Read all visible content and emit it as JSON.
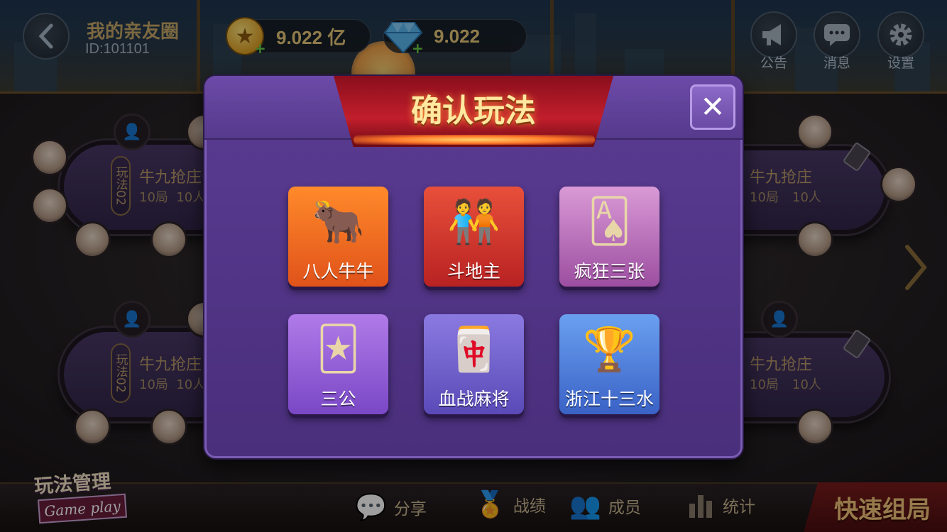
{
  "header": {
    "club_name": "我的亲友圈",
    "club_id": "ID:101101",
    "gold": "9.022 亿",
    "diamonds": "9.022",
    "notice_label": "公告",
    "message_label": "消息",
    "settings_label": "设置"
  },
  "tables": {
    "left_top": {
      "tag": "玩法02",
      "title": "牛九抢庄",
      "sub": "10局  10人"
    },
    "left_bottom": {
      "tag": "玩法02",
      "title": "牛九抢庄",
      "sub": "10局  10人"
    },
    "right_top": {
      "title": "牛九抢庄",
      "rounds": "10局",
      "players": "10人"
    },
    "right_bottom": {
      "title": "牛九抢庄",
      "rounds": "10局",
      "players": "10人"
    }
  },
  "modal": {
    "title": "确认玩法",
    "close_glyph": "✕",
    "games": [
      {
        "label": "八人牛牛",
        "icon": "bull-mascot-icon",
        "color": "#ff8a2a"
      },
      {
        "label": "斗地主",
        "icon": "landlord-characters-icon",
        "color": "#e8503a"
      },
      {
        "label": "疯狂三张",
        "icon": "playing-cards-icon",
        "color": "#d99ad6"
      },
      {
        "label": "三公",
        "icon": "cards-and-coins-icon",
        "color": "#b07ae8"
      },
      {
        "label": "血战麻将",
        "icon": "mahjong-tile-icon",
        "color": "#8a7ae0"
      },
      {
        "label": "浙江十三水",
        "icon": "trophy-cards-icon",
        "color": "#6aa0f0"
      }
    ]
  },
  "bottom": {
    "mgmt_title": "玩法管理",
    "mgmt_sub": "Game play",
    "share": "分享",
    "records": "战绩",
    "members": "成员",
    "stats": "统计",
    "quick_start": "快速组局"
  },
  "colors": {
    "modal_bg": "#4a2f7c",
    "title_banner": "#c21e2c",
    "accent_gold": "#e9c97a"
  }
}
